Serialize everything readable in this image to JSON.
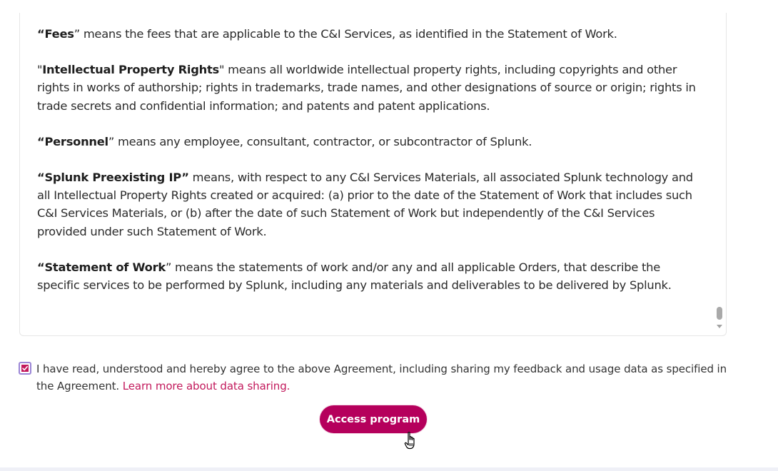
{
  "agreement": {
    "paragraphs": [
      {
        "open": "“",
        "term": "Fees",
        "close": "”",
        "body": " means the fees that are applicable to the C&I Services, as identified in the Statement of Work."
      },
      {
        "open": "\"",
        "term": "Intellectual Property Rights",
        "close": "\"",
        "body": " means all worldwide intellectual property rights, including copyrights and other rights in works of authorship; rights in trademarks, trade names, and other designations of source or origin; rights in trade secrets and confidential information; and patents and patent applications."
      },
      {
        "open": "“",
        "term": "Personnel",
        "close": "”",
        "body": " means any employee, consultant, contractor, or subcontractor of Splunk."
      },
      {
        "open": "“",
        "term": "Splunk Preexisting IP",
        "close": "”",
        "body": " means, with respect to any C&I Services Materials, all associated Splunk technology and all Intellectual Property Rights created or acquired: (a) prior to the date of the Statement of Work that includes such C&I Services Materials, or (b) after the date of such Statement of Work but independently of the C&I Services provided under such Statement of Work."
      },
      {
        "open": "“",
        "term": "Statement of Work",
        "close": "”",
        "body": " means the statements of work and/or any and all applicable Orders, that describe the specific services to be performed by Splunk, including any materials and deliverables to be delivered by Splunk."
      }
    ]
  },
  "consent": {
    "checked": true,
    "text": "I have read, understood and hereby agree to the above Agreement, including sharing my feedback and usage data as specified in the Agreement. ",
    "link_text": "Learn more about data sharing."
  },
  "access_button": {
    "label": "Access program"
  },
  "colors": {
    "accent": "#b5005c",
    "link": "#c2185b",
    "checkbox_border": "#9b86d6"
  },
  "icons": {
    "checkbox": "checkmark-icon",
    "cursor": "hand-pointer-icon",
    "scroll": "scroll-down-arrow-icon"
  }
}
